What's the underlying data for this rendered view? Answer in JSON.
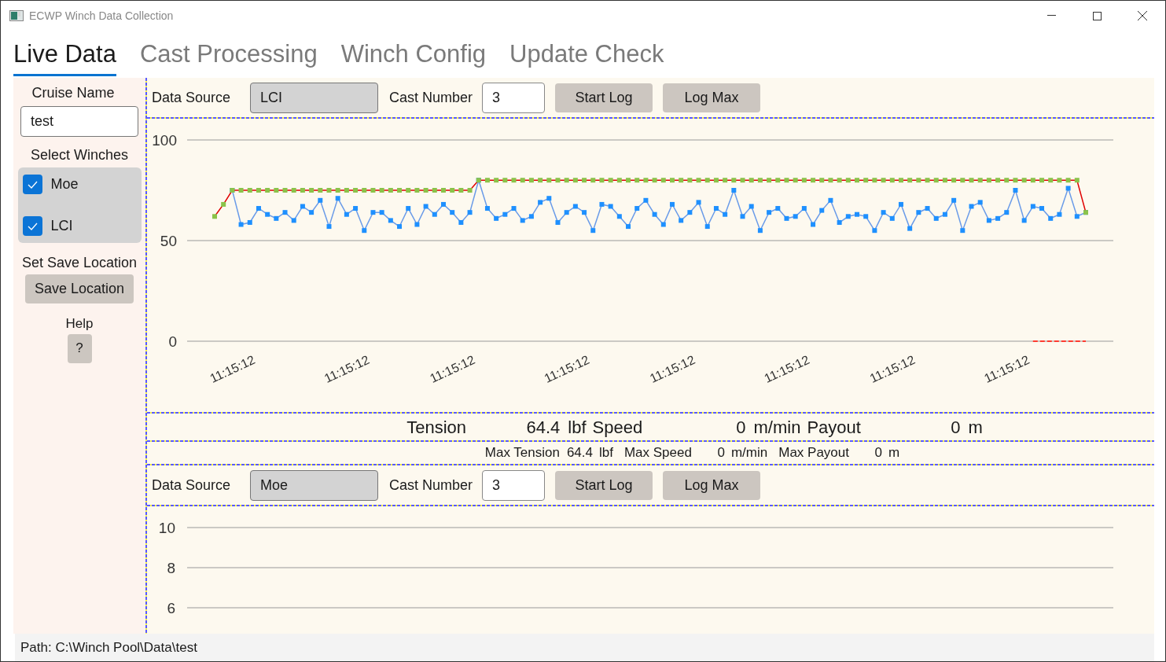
{
  "window": {
    "title": "ECWP Winch Data Collection"
  },
  "tabs": [
    {
      "label": "Live Data",
      "selected": true
    },
    {
      "label": "Cast Processing",
      "selected": false
    },
    {
      "label": "Winch Config",
      "selected": false
    },
    {
      "label": "Update Check",
      "selected": false
    }
  ],
  "sidebar": {
    "cruise_name_label": "Cruise Name",
    "cruise_name_value": "test",
    "select_winches_label": "Select Winches",
    "winches": [
      {
        "label": "Moe",
        "checked": true
      },
      {
        "label": "LCI",
        "checked": true
      }
    ],
    "save_location_label": "Set Save Location",
    "save_location_button": "Save Location",
    "help_label": "Help",
    "help_button": "?"
  },
  "panels": [
    {
      "data_source_label": "Data Source",
      "data_source_value": "LCI",
      "cast_number_label": "Cast Number",
      "cast_number_value": "3",
      "buttons": [
        "Start Log",
        "Log Max"
      ],
      "chart_data": {
        "type": "line",
        "ylim": [
          0,
          100
        ],
        "yticks": [
          0,
          50,
          100
        ],
        "categories": [
          null,
          null,
          "11:15:12",
          null,
          null,
          null,
          null,
          null,
          null,
          null,
          null,
          null,
          null,
          null,
          null,
          "11:15:12",
          null,
          null,
          null,
          null,
          null,
          null,
          null,
          null,
          null,
          null,
          null,
          "11:15:12",
          null,
          null,
          null,
          null,
          null,
          null,
          null,
          null,
          null,
          null,
          null,
          null,
          "11:15:12",
          null,
          null,
          null,
          null,
          null,
          null,
          null,
          null,
          null,
          null,
          null,
          "11:15:12",
          null,
          null,
          null,
          null,
          null,
          null,
          null,
          null,
          null,
          null,
          null,
          null,
          "11:15:12",
          null,
          null,
          null,
          null,
          null,
          null,
          null,
          null,
          null,
          null,
          null,
          "11:15:12",
          null,
          null,
          null,
          null,
          null,
          null,
          null,
          null,
          null,
          null,
          null,
          null,
          "11:15:12",
          null,
          null,
          null,
          null,
          null,
          null,
          null,
          null,
          null
        ],
        "series": [
          {
            "color": "#1e90ff",
            "marker": "square",
            "line_style": "solid",
            "values": [
              null,
              null,
              75,
              58,
              59,
              66,
              63,
              61,
              64,
              60,
              67,
              64,
              70,
              57,
              71,
              63,
              66,
              55,
              64,
              64,
              60,
              57,
              66,
              58,
              67,
              63,
              68,
              64,
              59,
              64,
              80,
              66,
              61,
              63,
              66,
              60,
              62,
              69,
              71,
              59,
              64,
              67,
              64,
              55,
              68,
              67,
              62,
              57,
              66,
              70,
              63,
              58,
              68,
              60,
              64,
              69,
              57,
              66,
              63,
              75,
              62,
              67,
              55,
              64,
              66,
              61,
              62,
              66,
              58,
              65,
              70,
              59,
              62,
              63,
              62,
              55,
              64,
              61,
              68,
              56,
              64,
              66,
              61,
              63,
              70,
              55,
              67,
              69,
              60,
              61,
              64,
              75,
              60,
              67,
              66,
              61,
              63,
              76,
              62,
              64
            ]
          },
          {
            "color": "#8bc34a",
            "marker": "square",
            "line_style": "solid",
            "values": [
              62,
              68,
              75,
              75,
              75,
              75,
              75,
              75,
              75,
              75,
              75,
              75,
              75,
              75,
              75,
              75,
              75,
              75,
              75,
              75,
              75,
              75,
              75,
              75,
              75,
              75,
              75,
              75,
              75,
              75,
              80,
              80,
              80,
              80,
              80,
              80,
              80,
              80,
              80,
              80,
              80,
              80,
              80,
              80,
              80,
              80,
              80,
              80,
              80,
              80,
              80,
              80,
              80,
              80,
              80,
              80,
              80,
              80,
              80,
              80,
              80,
              80,
              80,
              80,
              80,
              80,
              80,
              80,
              80,
              80,
              80,
              80,
              80,
              80,
              80,
              80,
              80,
              80,
              80,
              80,
              80,
              80,
              80,
              80,
              80,
              80,
              80,
              80,
              80,
              80,
              80,
              80,
              80,
              80,
              80,
              80,
              80,
              80,
              80,
              64
            ]
          },
          {
            "color": "#ff3b30",
            "line_style": "dashed",
            "values": [
              null,
              null,
              null,
              null,
              null,
              null,
              null,
              null,
              null,
              null,
              null,
              null,
              null,
              null,
              null,
              null,
              null,
              null,
              null,
              null,
              null,
              null,
              null,
              null,
              null,
              null,
              null,
              null,
              null,
              null,
              null,
              null,
              null,
              null,
              null,
              null,
              null,
              null,
              null,
              null,
              null,
              null,
              null,
              null,
              null,
              null,
              null,
              null,
              null,
              null,
              null,
              null,
              null,
              null,
              null,
              null,
              null,
              null,
              null,
              null,
              null,
              null,
              null,
              null,
              null,
              null,
              null,
              null,
              null,
              null,
              null,
              null,
              null,
              null,
              null,
              null,
              null,
              null,
              null,
              null,
              null,
              null,
              null,
              null,
              null,
              null,
              null,
              null,
              null,
              null,
              null,
              null,
              null,
              0,
              0,
              0,
              0,
              0,
              0,
              0
            ]
          }
        ]
      },
      "readouts": [
        [
          {
            "label": "Tension",
            "value": "64.4",
            "unit": "lbf"
          },
          {
            "label": "Speed",
            "value": "0",
            "unit": "m/min"
          },
          {
            "label": "Payout",
            "value": "0",
            "unit": "m"
          }
        ],
        [
          {
            "label": "Max Tension",
            "value": "64.4",
            "unit": "lbf"
          },
          {
            "label": "Max Speed",
            "value": "0",
            "unit": "m/min"
          },
          {
            "label": "Max Payout",
            "value": "0",
            "unit": "m"
          }
        ]
      ]
    },
    {
      "data_source_label": "Data Source",
      "data_source_value": "Moe",
      "cast_number_label": "Cast Number",
      "cast_number_value": "3",
      "buttons": [
        "Start Log",
        "Log Max"
      ],
      "y_axis_labels": [
        "10",
        "8",
        "6"
      ]
    }
  ],
  "status_bar": {
    "path": "Path: C:\\Winch Pool\\Data\\test"
  }
}
